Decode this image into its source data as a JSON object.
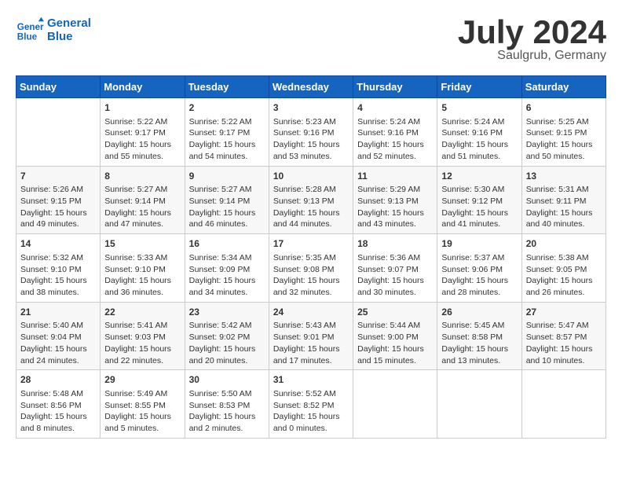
{
  "header": {
    "logo_line1": "General",
    "logo_line2": "Blue",
    "month": "July 2024",
    "location": "Saulgrub, Germany"
  },
  "days_of_week": [
    "Sunday",
    "Monday",
    "Tuesday",
    "Wednesday",
    "Thursday",
    "Friday",
    "Saturday"
  ],
  "weeks": [
    [
      {
        "day": "",
        "info": ""
      },
      {
        "day": "1",
        "info": "Sunrise: 5:22 AM\nSunset: 9:17 PM\nDaylight: 15 hours\nand 55 minutes."
      },
      {
        "day": "2",
        "info": "Sunrise: 5:22 AM\nSunset: 9:17 PM\nDaylight: 15 hours\nand 54 minutes."
      },
      {
        "day": "3",
        "info": "Sunrise: 5:23 AM\nSunset: 9:16 PM\nDaylight: 15 hours\nand 53 minutes."
      },
      {
        "day": "4",
        "info": "Sunrise: 5:24 AM\nSunset: 9:16 PM\nDaylight: 15 hours\nand 52 minutes."
      },
      {
        "day": "5",
        "info": "Sunrise: 5:24 AM\nSunset: 9:16 PM\nDaylight: 15 hours\nand 51 minutes."
      },
      {
        "day": "6",
        "info": "Sunrise: 5:25 AM\nSunset: 9:15 PM\nDaylight: 15 hours\nand 50 minutes."
      }
    ],
    [
      {
        "day": "7",
        "info": "Sunrise: 5:26 AM\nSunset: 9:15 PM\nDaylight: 15 hours\nand 49 minutes."
      },
      {
        "day": "8",
        "info": "Sunrise: 5:27 AM\nSunset: 9:14 PM\nDaylight: 15 hours\nand 47 minutes."
      },
      {
        "day": "9",
        "info": "Sunrise: 5:27 AM\nSunset: 9:14 PM\nDaylight: 15 hours\nand 46 minutes."
      },
      {
        "day": "10",
        "info": "Sunrise: 5:28 AM\nSunset: 9:13 PM\nDaylight: 15 hours\nand 44 minutes."
      },
      {
        "day": "11",
        "info": "Sunrise: 5:29 AM\nSunset: 9:13 PM\nDaylight: 15 hours\nand 43 minutes."
      },
      {
        "day": "12",
        "info": "Sunrise: 5:30 AM\nSunset: 9:12 PM\nDaylight: 15 hours\nand 41 minutes."
      },
      {
        "day": "13",
        "info": "Sunrise: 5:31 AM\nSunset: 9:11 PM\nDaylight: 15 hours\nand 40 minutes."
      }
    ],
    [
      {
        "day": "14",
        "info": "Sunrise: 5:32 AM\nSunset: 9:10 PM\nDaylight: 15 hours\nand 38 minutes."
      },
      {
        "day": "15",
        "info": "Sunrise: 5:33 AM\nSunset: 9:10 PM\nDaylight: 15 hours\nand 36 minutes."
      },
      {
        "day": "16",
        "info": "Sunrise: 5:34 AM\nSunset: 9:09 PM\nDaylight: 15 hours\nand 34 minutes."
      },
      {
        "day": "17",
        "info": "Sunrise: 5:35 AM\nSunset: 9:08 PM\nDaylight: 15 hours\nand 32 minutes."
      },
      {
        "day": "18",
        "info": "Sunrise: 5:36 AM\nSunset: 9:07 PM\nDaylight: 15 hours\nand 30 minutes."
      },
      {
        "day": "19",
        "info": "Sunrise: 5:37 AM\nSunset: 9:06 PM\nDaylight: 15 hours\nand 28 minutes."
      },
      {
        "day": "20",
        "info": "Sunrise: 5:38 AM\nSunset: 9:05 PM\nDaylight: 15 hours\nand 26 minutes."
      }
    ],
    [
      {
        "day": "21",
        "info": "Sunrise: 5:40 AM\nSunset: 9:04 PM\nDaylight: 15 hours\nand 24 minutes."
      },
      {
        "day": "22",
        "info": "Sunrise: 5:41 AM\nSunset: 9:03 PM\nDaylight: 15 hours\nand 22 minutes."
      },
      {
        "day": "23",
        "info": "Sunrise: 5:42 AM\nSunset: 9:02 PM\nDaylight: 15 hours\nand 20 minutes."
      },
      {
        "day": "24",
        "info": "Sunrise: 5:43 AM\nSunset: 9:01 PM\nDaylight: 15 hours\nand 17 minutes."
      },
      {
        "day": "25",
        "info": "Sunrise: 5:44 AM\nSunset: 9:00 PM\nDaylight: 15 hours\nand 15 minutes."
      },
      {
        "day": "26",
        "info": "Sunrise: 5:45 AM\nSunset: 8:58 PM\nDaylight: 15 hours\nand 13 minutes."
      },
      {
        "day": "27",
        "info": "Sunrise: 5:47 AM\nSunset: 8:57 PM\nDaylight: 15 hours\nand 10 minutes."
      }
    ],
    [
      {
        "day": "28",
        "info": "Sunrise: 5:48 AM\nSunset: 8:56 PM\nDaylight: 15 hours\nand 8 minutes."
      },
      {
        "day": "29",
        "info": "Sunrise: 5:49 AM\nSunset: 8:55 PM\nDaylight: 15 hours\nand 5 minutes."
      },
      {
        "day": "30",
        "info": "Sunrise: 5:50 AM\nSunset: 8:53 PM\nDaylight: 15 hours\nand 2 minutes."
      },
      {
        "day": "31",
        "info": "Sunrise: 5:52 AM\nSunset: 8:52 PM\nDaylight: 15 hours\nand 0 minutes."
      },
      {
        "day": "",
        "info": ""
      },
      {
        "day": "",
        "info": ""
      },
      {
        "day": "",
        "info": ""
      }
    ]
  ]
}
